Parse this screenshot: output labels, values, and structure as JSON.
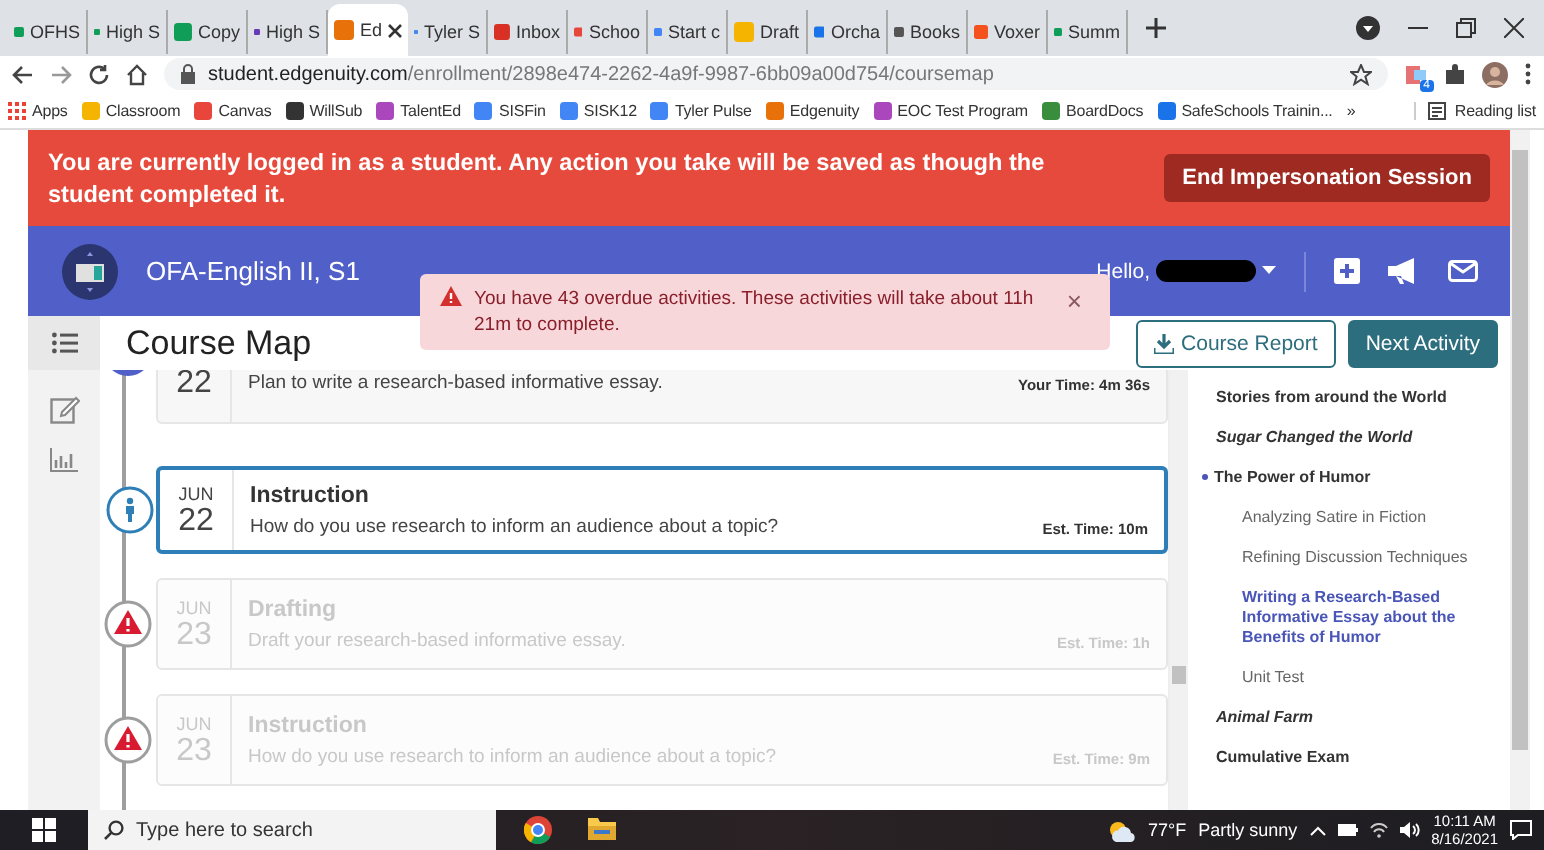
{
  "browser": {
    "tabs": [
      {
        "label": "OFHS",
        "selected": false
      },
      {
        "label": "High S",
        "selected": false
      },
      {
        "label": "Copy",
        "selected": false
      },
      {
        "label": "High S",
        "selected": false
      },
      {
        "label": "Ed",
        "selected": true
      },
      {
        "label": "Tyler S",
        "selected": false
      },
      {
        "label": "Inbox",
        "selected": false
      },
      {
        "label": "Schoo",
        "selected": false
      },
      {
        "label": "Start c",
        "selected": false
      },
      {
        "label": "Draft",
        "selected": false
      },
      {
        "label": "Orcha",
        "selected": false
      },
      {
        "label": "Books",
        "selected": false
      },
      {
        "label": "Voxer",
        "selected": false
      },
      {
        "label": "Summ",
        "selected": false
      }
    ],
    "address": {
      "domain": "student.edgenuity.com",
      "path": "/enrollment/2898e474-2262-4a9f-9987-6bb09a00d754/coursemap"
    },
    "extension_badge": "4",
    "bookmarks": [
      "Apps",
      "Classroom",
      "Canvas",
      "WillSub",
      "TalentEd",
      "SISFin",
      "SISK12",
      "Tyler Pulse",
      "Edgenuity",
      "EOC Test Program",
      "BoardDocs",
      "SafeSchools Trainin..."
    ],
    "more": "»",
    "reading_list": "Reading list"
  },
  "banner": {
    "text": "You are currently logged in as a student. Any action you take will be saved as though the student completed it.",
    "button": "End Impersonation Session"
  },
  "header": {
    "course": "OFA-English II, S1",
    "greeting": "Hello,"
  },
  "alert": {
    "text": "You have 43 overdue activities. These activities will take about 11h 21m to complete.",
    "close": "×"
  },
  "course_map": {
    "title": "Course Map",
    "report_button": "Course Report",
    "next_button": "Next Activity"
  },
  "activities": [
    {
      "kind": "done",
      "selected": false,
      "day": "22",
      "description": "Plan to write a research-based informative essay.",
      "time": "Your Time: 4m 36s"
    },
    {
      "kind": "current",
      "selected": true,
      "month": "JUN",
      "day": "22",
      "title": "Instruction",
      "description": "How do you use research to inform an audience about a topic?",
      "time": "Est. Time: 10m"
    },
    {
      "kind": "overdue",
      "selected": false,
      "month": "JUN",
      "day": "23",
      "title": "Drafting",
      "description": "Draft your research-based informative essay.",
      "time": "Est. Time: 1h"
    },
    {
      "kind": "overdue",
      "selected": false,
      "month": "JUN",
      "day": "23",
      "title": "Instruction",
      "description": "How do you use research to inform an audience about a topic?",
      "time": "Est. Time: 9m"
    }
  ],
  "outline": [
    {
      "kind": "unit",
      "label": "Stories from around the World",
      "expanded": false
    },
    {
      "kind": "novel",
      "label": "Sugar Changed the World",
      "expanded": false
    },
    {
      "kind": "unit",
      "label": "The Power of Humor",
      "expanded": true,
      "children": [
        {
          "label": "Analyzing Satire in Fiction",
          "selected": false
        },
        {
          "label": "Refining Discussion Techniques",
          "selected": false
        },
        {
          "label": "Writing a Research-Based Informative Essay about the Benefits of Humor",
          "selected": true
        },
        {
          "label": "Unit Test",
          "selected": false
        }
      ]
    },
    {
      "kind": "novel",
      "label": "Animal Farm",
      "expanded": false
    },
    {
      "kind": "unit",
      "label": "Cumulative Exam",
      "expanded": false
    }
  ],
  "taskbar": {
    "search_placeholder": "Type here to search",
    "temperature": "77°F",
    "weather": "Partly sunny",
    "time": "10:11 AM",
    "date": "8/16/2021"
  }
}
